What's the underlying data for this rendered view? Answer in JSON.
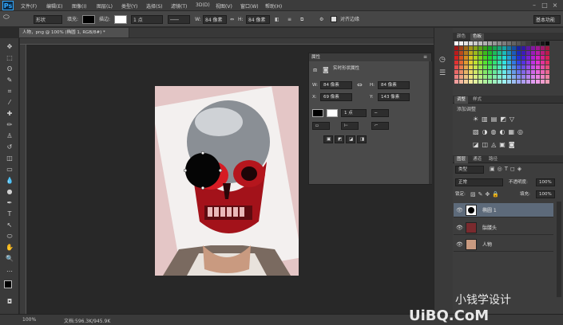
{
  "menubar": {
    "logo": "Ps",
    "items": [
      "文件(F)",
      "编辑(E)",
      "图像(I)",
      "图层(L)",
      "类型(Y)",
      "选择(S)",
      "滤镜(T)",
      "3D(D)",
      "视图(V)",
      "窗口(W)",
      "帮助(H)"
    ]
  },
  "options": {
    "mode": "形状",
    "fill_label": "填充:",
    "stroke_label": "描边:",
    "stroke_size": "1 点",
    "w_label": "W:",
    "w_value": "84 像素",
    "h_label": "H:",
    "h_value": "84 像素",
    "align_label": "对齐边缘",
    "workspace": "基本功能"
  },
  "document": {
    "tab_title": "人物，png @ 100% (椭圆 1, RGB/8#) *"
  },
  "properties": {
    "title": "属性",
    "subtitle": "实时形状属性",
    "w_label": "W:",
    "w_value": "84 像素",
    "h_label": "H:",
    "h_value": "84 像素",
    "x_label": "X:",
    "x_value": "69 像素",
    "y_label": "Y:",
    "y_value": "143 像素",
    "stroke_size": "1 点"
  },
  "swatches_panel": {
    "tab1": "颜色",
    "tab2": "色板"
  },
  "adjust_panel": {
    "tab1": "调整",
    "tab2": "样式",
    "label": "添加调整"
  },
  "layers_panel": {
    "tab1": "图层",
    "tab2": "通道",
    "tab3": "路径",
    "filter": "类型",
    "blend": "正常",
    "opacity_label": "不透明度:",
    "opacity": "100%",
    "lock_label": "锁定:",
    "fill_label": "填充:",
    "fill": "100%",
    "layers": [
      {
        "name": "椭圆 1",
        "selected": true
      },
      {
        "name": "骷髅头",
        "selected": false
      },
      {
        "name": "人物",
        "selected": false
      }
    ]
  },
  "status": {
    "zoom": "100%",
    "doc": "文档:596.3K/945.9K"
  },
  "watermark": {
    "line1": "小钱学设计",
    "line2": "UiBQ.CoM"
  },
  "colors": {
    "accent": "#31a8ff",
    "selected_layer": "#5d6a7a"
  }
}
